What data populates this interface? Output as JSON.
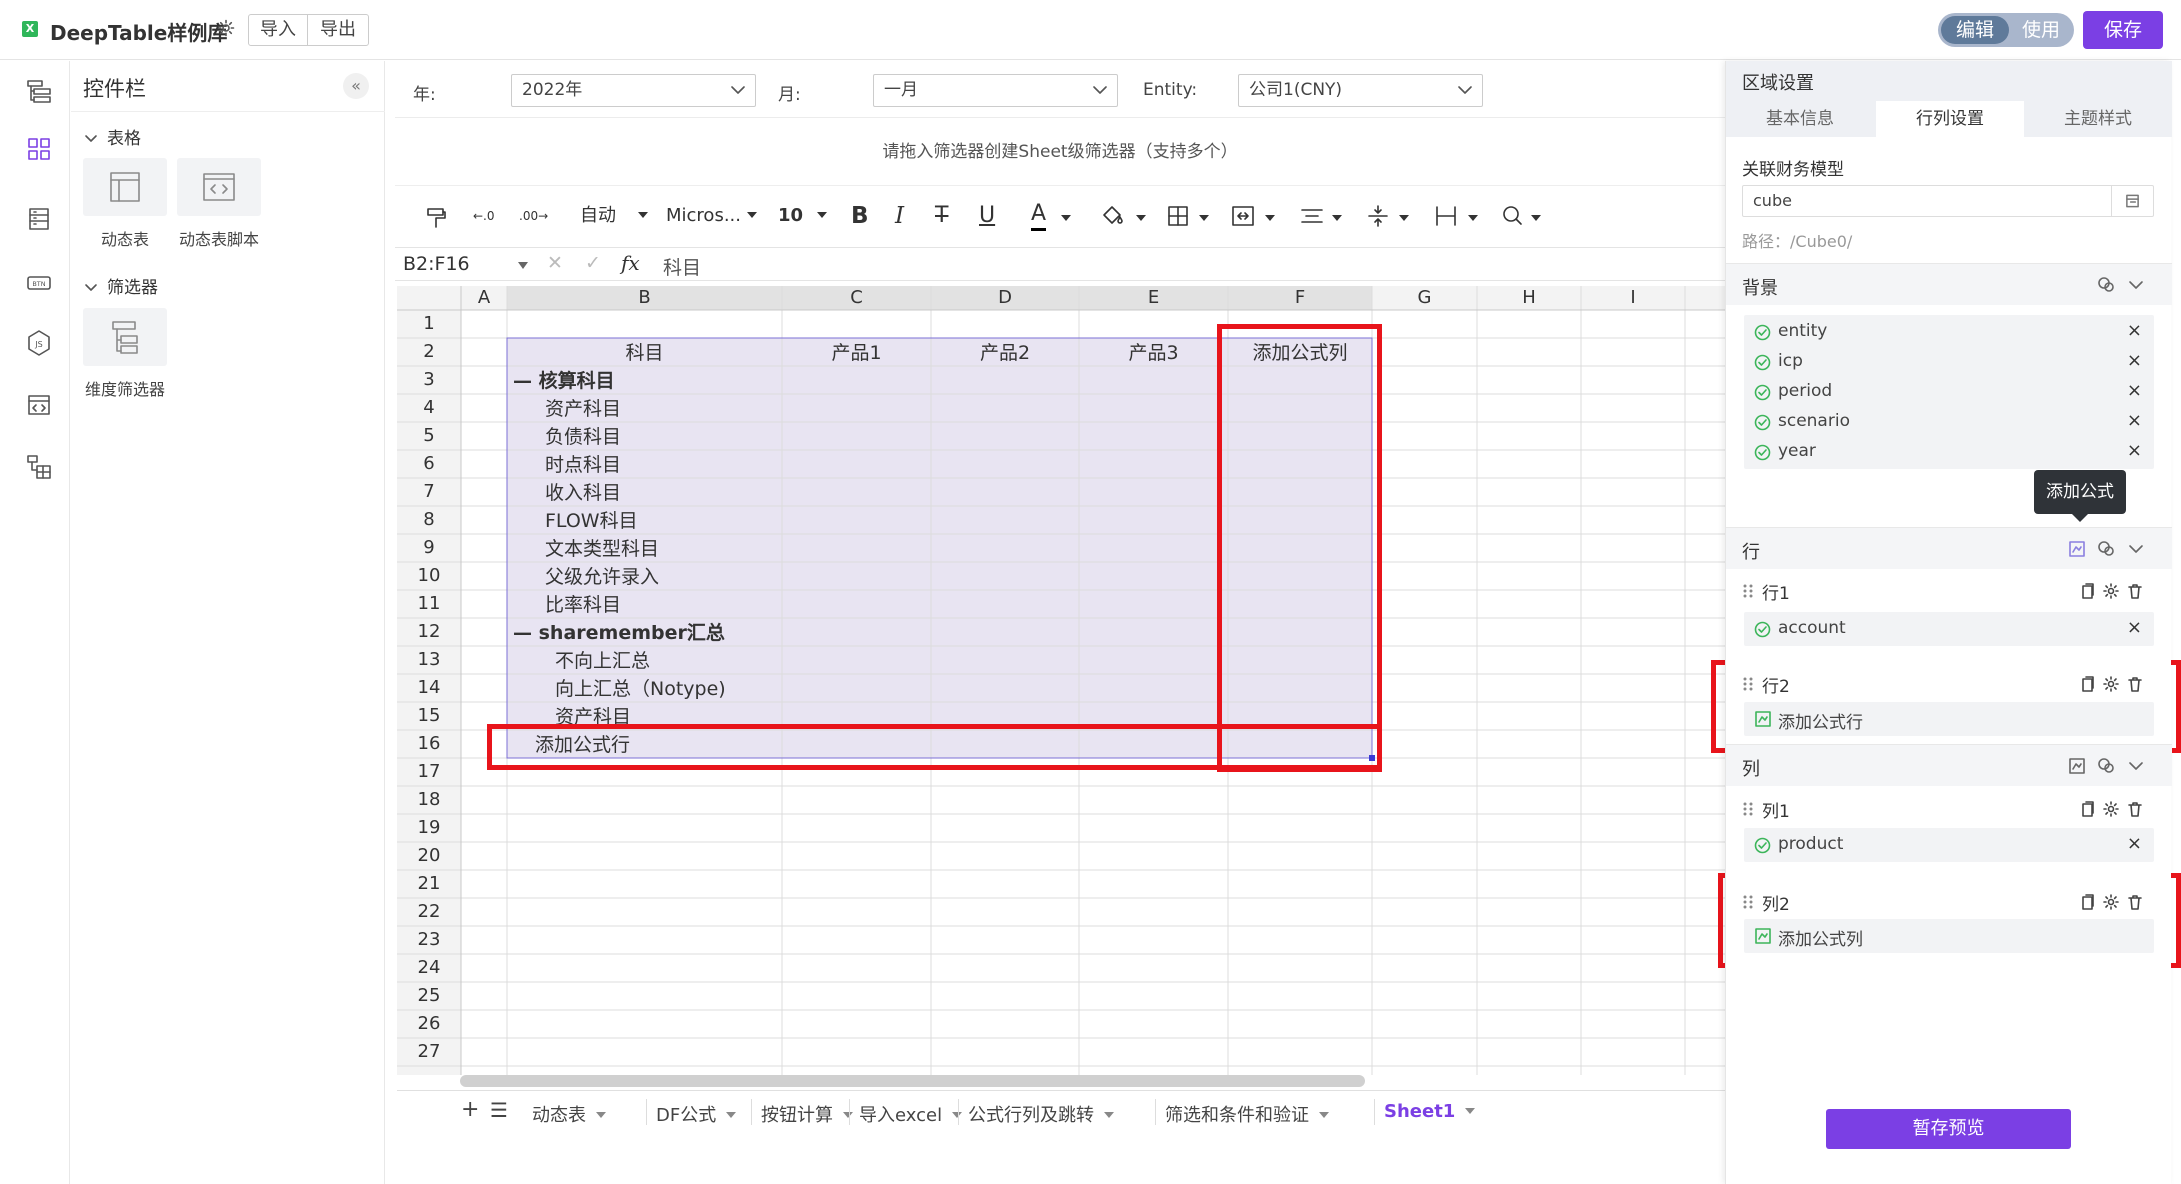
{
  "app": {
    "logo_letter": "X",
    "title": "DeepTable样例库",
    "import_label": "导入",
    "export_label": "导出",
    "mode_edit": "编辑",
    "mode_use": "使用",
    "save_label": "保存"
  },
  "widget_panel": {
    "title": "控件栏",
    "collapse": "«",
    "groups": [
      {
        "label": "表格",
        "items": [
          "动态表",
          "动态表脚本"
        ]
      },
      {
        "label": "筛选器",
        "items": [
          "维度筛选器"
        ]
      }
    ]
  },
  "filters": [
    {
      "label": "年:",
      "value": "2022年"
    },
    {
      "label": "月:",
      "value": "一月"
    },
    {
      "label": "Entity:",
      "value": "公司1(CNY)"
    }
  ],
  "drop_hint": "请拖入筛选器创建Sheet级筛选器（支持多个）",
  "toolbar": {
    "auto": "自动",
    "font": "Micros...",
    "size": "10",
    "bold": "B",
    "italic": "I",
    "strike": "T",
    "underline": "U",
    "font_color": "A",
    "font_color_hex": "#000000"
  },
  "formula_bar": {
    "cell_ref": "B2:F16",
    "x": "✕",
    "check": "✓",
    "fx": "fx",
    "value": "科目"
  },
  "grid": {
    "columns": [
      "A",
      "B",
      "C",
      "D",
      "E",
      "F",
      "G",
      "H",
      "I"
    ],
    "rows": [
      "1",
      "2",
      "3",
      "4",
      "5",
      "6",
      "7",
      "8",
      "9",
      "10",
      "11",
      "12",
      "13",
      "14",
      "15",
      "16",
      "17",
      "18",
      "19",
      "20",
      "21",
      "22",
      "23",
      "24",
      "25",
      "26",
      "27"
    ],
    "header_row": [
      "科目",
      "产品1",
      "产品2",
      "产品3",
      "添加公式列"
    ],
    "body": [
      {
        "prefix": "—",
        "text": "核算科目",
        "bold": true,
        "indent": 0
      },
      {
        "text": "资产科目",
        "indent": 1
      },
      {
        "text": "负债科目",
        "indent": 1
      },
      {
        "text": "时点科目",
        "indent": 1
      },
      {
        "text": "收入科目",
        "indent": 1
      },
      {
        "text": "FLOW科目",
        "indent": 1
      },
      {
        "text": "文本类型科目",
        "indent": 1
      },
      {
        "text": "父级允许录入",
        "indent": 1
      },
      {
        "text": "比率科目",
        "indent": 1
      },
      {
        "prefix": "—",
        "text": "sharemember汇总",
        "bold": true,
        "indent": 0
      },
      {
        "text": "不向上汇总",
        "indent": 2
      },
      {
        "text": "向上汇总（Notype)",
        "indent": 2
      },
      {
        "text": "资产科目",
        "indent": 2
      },
      {
        "text": "添加公式行",
        "indent": 3
      }
    ],
    "selection_fill": "#e8e4f2",
    "highlight_color": "#e8141b"
  },
  "sheet_tabs": {
    "add": "+",
    "menu": "☰",
    "tabs": [
      "动态表",
      "DF公式",
      "按钮计算",
      "导入excel",
      "公式行列及跳转",
      "筛选和条件和验证",
      "Sheet1"
    ],
    "active": "Sheet1",
    "active_color": "#7b3fe4"
  },
  "right_panel": {
    "title": "区域设置",
    "tabs": [
      "基本信息",
      "行列设置",
      "主题样式"
    ],
    "active_tab": "行列设置",
    "model_label": "关联财务模型",
    "model_value": "cube",
    "model_path": "路径：/Cube0/",
    "background": {
      "title": "背景",
      "dims": [
        "entity",
        "icp",
        "period",
        "scenario",
        "year"
      ]
    },
    "rows": {
      "title": "行",
      "groups": [
        {
          "name": "行1",
          "item": "account"
        },
        {
          "name": "行2",
          "item": "添加公式行"
        }
      ]
    },
    "cols": {
      "title": "列",
      "groups": [
        {
          "name": "列1",
          "item": "product"
        },
        {
          "name": "列2",
          "item": "添加公式列"
        }
      ]
    },
    "remove": "×",
    "tooltip": "添加公式",
    "preview_label": "暂存预览",
    "accent": "#7b3fe4"
  }
}
